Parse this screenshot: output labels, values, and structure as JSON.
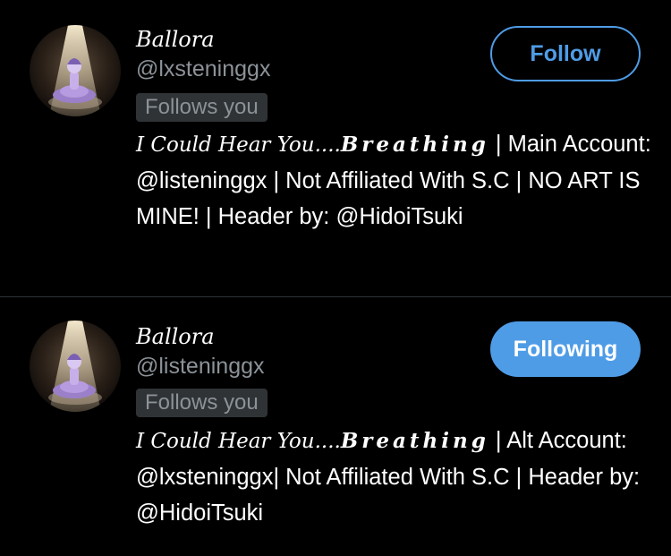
{
  "accent_color": "#4f9ce6",
  "accounts": [
    {
      "display_name": "Ballora",
      "handle": "@lxsteninggx",
      "follows_you": "Follows you",
      "button_label": "Follow",
      "avatar_icon": "ballora-spotlight-avatar",
      "bio": {
        "prefix": "I Could Hear You....",
        "styled": "Breathing",
        "rest": "| Main Account: @listeninggx | Not Affiliated With S.C | NO ART IS MINE! | Header by: @HidoiTsuki"
      }
    },
    {
      "display_name": "Ballora",
      "handle": "@listeninggx",
      "follows_you": "Follows you",
      "button_label": "Following",
      "avatar_icon": "ballora-spotlight-avatar",
      "bio": {
        "prefix": "I Could Hear You....",
        "styled": "Breathing",
        "rest": "| Alt Account: @lxsteninggx| Not Affiliated With S.C | Header by: @HidoiTsuki"
      }
    }
  ]
}
